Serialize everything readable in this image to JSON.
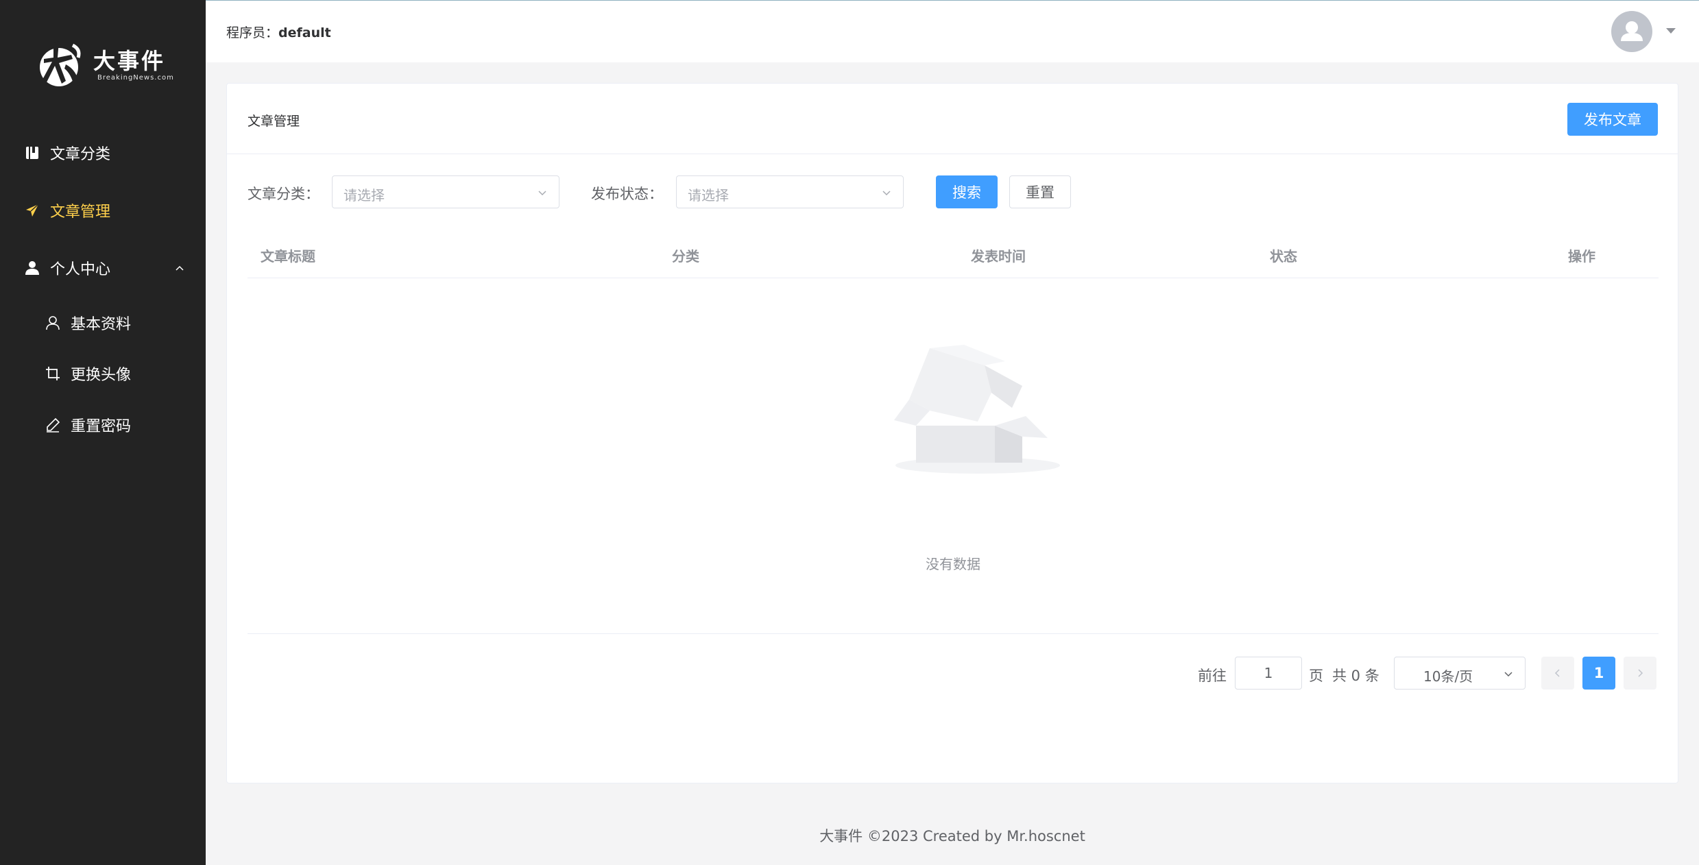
{
  "sidebar": {
    "logo": {
      "name": "大事件",
      "sub": "BreakingNews.com"
    },
    "items": [
      {
        "label": "文章分类",
        "icon": "book-icon"
      },
      {
        "label": "文章管理",
        "icon": "send-icon",
        "active": true
      },
      {
        "label": "个人中心",
        "icon": "user-icon",
        "expanded": true
      }
    ],
    "sub_items": [
      {
        "label": "基本资料",
        "icon": "user-outline-icon"
      },
      {
        "label": "更换头像",
        "icon": "crop-icon"
      },
      {
        "label": "重置密码",
        "icon": "edit-pen-icon"
      }
    ]
  },
  "header": {
    "user_prefix": "程序员：",
    "user_name": "default"
  },
  "card": {
    "title": "文章管理",
    "publish_button": "发布文章",
    "filters": {
      "category_label": "文章分类：",
      "category_placeholder": "请选择",
      "status_label": "发布状态：",
      "status_placeholder": "请选择",
      "search_button": "搜索",
      "reset_button": "重置"
    },
    "table": {
      "columns": [
        "文章标题",
        "分类",
        "发表时间",
        "状态",
        "操作"
      ],
      "empty_text": "没有数据"
    },
    "pagination": {
      "goto_prefix": "前往",
      "goto_value": "1",
      "goto_suffix": "页",
      "total_text": "共 0 条",
      "page_size": "10条/页",
      "current_page": "1"
    }
  },
  "footer": {
    "text": "大事件 ©2023 Created by Mr.hoscnet"
  },
  "colors": {
    "primary": "#409eff",
    "active_menu": "#ffd04b",
    "sidebar_bg": "#232323"
  }
}
